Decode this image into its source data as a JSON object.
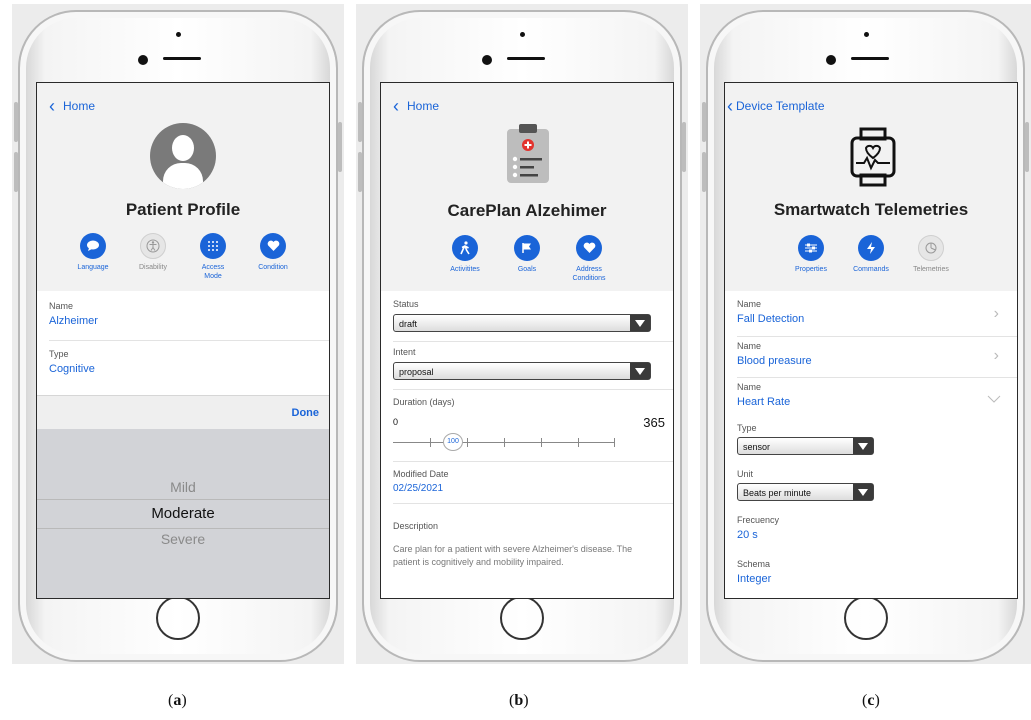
{
  "phone_a": {
    "back_label": "Home",
    "title": "Patient Profile",
    "icons": [
      {
        "label": "Language",
        "icon": "speech-bubble-icon",
        "active": true
      },
      {
        "label": "Disability",
        "icon": "accessibility-icon",
        "active": false
      },
      {
        "label": "Access Mode",
        "icon": "keypad-icon",
        "active": true
      },
      {
        "label": "Condition",
        "icon": "heart-icon",
        "active": true
      }
    ],
    "fields": [
      {
        "label": "Name",
        "value": "Alzheimer"
      },
      {
        "label": "Type",
        "value": "Cognitive"
      }
    ],
    "done_label": "Done",
    "picker_options": [
      "Mild",
      "Moderate",
      "Severe"
    ],
    "picker_selected": "Moderate"
  },
  "phone_b": {
    "back_label": "Home",
    "title": "CarePlan Alzehimer",
    "icons": [
      {
        "label": "Activitites",
        "icon": "walking-icon",
        "active": true
      },
      {
        "label": "Goals",
        "icon": "flag-icon",
        "active": true
      },
      {
        "label": "Address Conditions",
        "icon": "heart-icon",
        "active": true
      }
    ],
    "status_label": "Status",
    "status_value": "draft",
    "intent_label": "Intent",
    "intent_value": "proposal",
    "duration_label": "Duration (days)",
    "duration_min": "0",
    "duration_max": "365",
    "duration_value": "100",
    "modified_label": "Modified Date",
    "modified_value": "02/25/2021",
    "description_label": "Description",
    "description_value": "Care plan for a patient with severe Alzheimer's disease. The patient is cognitively and mobility impaired."
  },
  "phone_c": {
    "back_label": "Device Template",
    "title": "Smartwatch Telemetries",
    "icons": [
      {
        "label": "Properties",
        "icon": "sliders-icon",
        "active": true
      },
      {
        "label": "Commands",
        "icon": "lightning-icon",
        "active": true
      },
      {
        "label": "Telemetries",
        "icon": "pie-chart-icon",
        "active": false
      }
    ],
    "items": [
      {
        "label": "Name",
        "value": "Fall Detection"
      },
      {
        "label": "Name",
        "value": "Blood preasure"
      },
      {
        "label": "Name",
        "value": "Heart Rate"
      }
    ],
    "type_label": "Type",
    "type_value": "sensor",
    "unit_label": "Unit",
    "unit_value": "Beats per minute",
    "frequency_label": "Frecuency",
    "frequency_value": "20 s",
    "schema_label": "Schema",
    "schema_value": "Integer"
  },
  "captions": {
    "a": "a",
    "b": "b",
    "c": "c"
  },
  "colors": {
    "accent": "#1a64d8",
    "background": "#ececec"
  }
}
